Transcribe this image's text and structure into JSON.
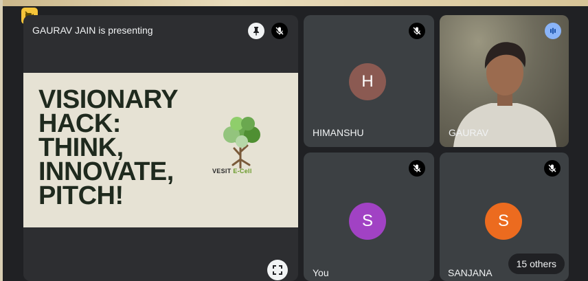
{
  "presenter": {
    "status_text": "GAURAV JAIN is presenting",
    "slide": {
      "title_lines": [
        "VISIONARY",
        "HACK:",
        "THINK,",
        "INNOVATE,",
        "PITCH!"
      ],
      "logo_text_a": "VESIT",
      "logo_text_b": "E-Cell"
    }
  },
  "participants": [
    {
      "name": "HIMANSHU",
      "initial": "H",
      "avatar_color": "#8b5a52",
      "muted": true
    },
    {
      "name": "GAURAV",
      "video": true,
      "speaking": true
    },
    {
      "name": "You",
      "initial": "S",
      "avatar_color": "#a142c4",
      "muted": true
    },
    {
      "name": "SANJANA",
      "initial": "S",
      "avatar_color": "#ec6b1f",
      "muted": true
    }
  ],
  "others_count_label": "15 others",
  "colors": {
    "accent_blue": "#8ab4f8",
    "tile_bg": "#3c4043",
    "camera_off_badge": "#f5c43a"
  }
}
